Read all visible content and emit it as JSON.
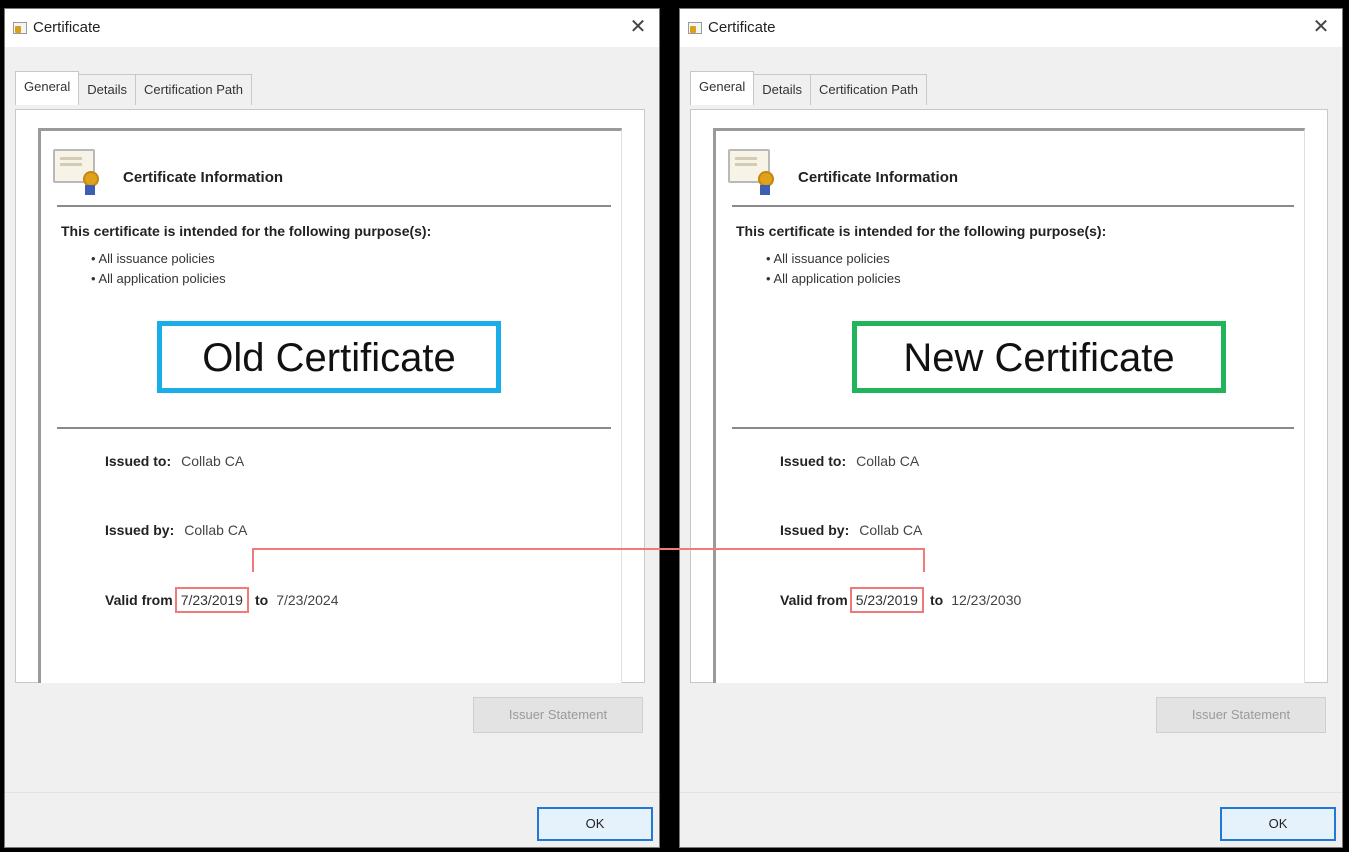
{
  "left_dialog": {
    "title": "Certificate",
    "close_glyph": "✕",
    "tabs": [
      {
        "label": "General"
      },
      {
        "label": "Details"
      },
      {
        "label": "Certification Path"
      }
    ],
    "info_heading": "Certificate Information",
    "purpose_heading": "This certificate is intended for the following purpose(s):",
    "purposes": [
      "All issuance policies",
      "All application policies"
    ],
    "overlay_label": "Old Certificate",
    "issued_to_label": "Issued to:",
    "issued_to_value": "Collab CA",
    "issued_by_label": "Issued by:",
    "issued_by_value": "Collab CA",
    "valid_from_label": "Valid from",
    "valid_from_value": "7/23/2019",
    "valid_to_word": "to",
    "valid_to_value": "7/23/2024",
    "issuer_statement_label": "Issuer Statement",
    "ok_label": "OK"
  },
  "right_dialog": {
    "title": "Certificate",
    "close_glyph": "✕",
    "tabs": [
      {
        "label": "General"
      },
      {
        "label": "Details"
      },
      {
        "label": "Certification Path"
      }
    ],
    "info_heading": "Certificate Information",
    "purpose_heading": "This certificate is intended for the following purpose(s):",
    "purposes": [
      "All issuance policies",
      "All application policies"
    ],
    "overlay_label": "New Certificate",
    "issued_to_label": "Issued to:",
    "issued_to_value": "Collab CA",
    "issued_by_label": "Issued by:",
    "issued_by_value": "Collab CA",
    "valid_from_label": "Valid from",
    "valid_from_value": "5/23/2019",
    "valid_to_word": "to",
    "valid_to_value": "12/23/2030",
    "issuer_statement_label": "Issuer Statement",
    "ok_label": "OK"
  },
  "colors": {
    "old_label_border": "#19aee8",
    "new_label_border": "#21b45a",
    "date_highlight": "#f07a7a",
    "ok_button_border": "#1f7ad6"
  },
  "icons": [
    "certificate-icon",
    "close-icon"
  ]
}
